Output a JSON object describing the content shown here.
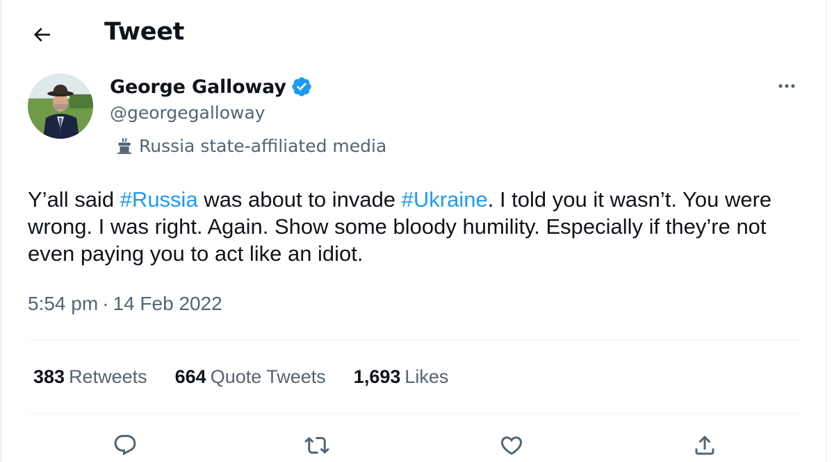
{
  "header": {
    "title": "Tweet",
    "back_icon": "back-arrow-icon"
  },
  "author": {
    "display_name": "George Galloway",
    "handle": "@georgegalloway",
    "verified": true,
    "verified_color": "#1d9bf0",
    "label": "Russia state-affiliated media",
    "label_icon": "podium-icon"
  },
  "tweet": {
    "segments": [
      {
        "text": "Y’all said ",
        "type": "text"
      },
      {
        "text": "#Russia",
        "type": "hashtag"
      },
      {
        "text": " was about to invade ",
        "type": "text"
      },
      {
        "text": "#Ukraine",
        "type": "hashtag"
      },
      {
        "text": ". I told you it wasn’t. You were wrong. I was right. Again. Show some bloody humility. Especially if they’re not even paying you to act like an idiot.",
        "type": "text"
      }
    ],
    "time": "5:54 pm",
    "separator": "·",
    "date": "14 Feb 2022"
  },
  "stats": {
    "retweets": {
      "count": "383",
      "label": "Retweets"
    },
    "quotes": {
      "count": "664",
      "label": "Quote Tweets"
    },
    "likes": {
      "count": "1,693",
      "label": "Likes"
    }
  },
  "actions": [
    "reply-icon",
    "retweet-icon",
    "like-icon",
    "share-icon"
  ],
  "colors": {
    "text": "#0f1419",
    "secondary": "#536471",
    "accent": "#1d9bf0",
    "divider": "#eff3f4"
  }
}
